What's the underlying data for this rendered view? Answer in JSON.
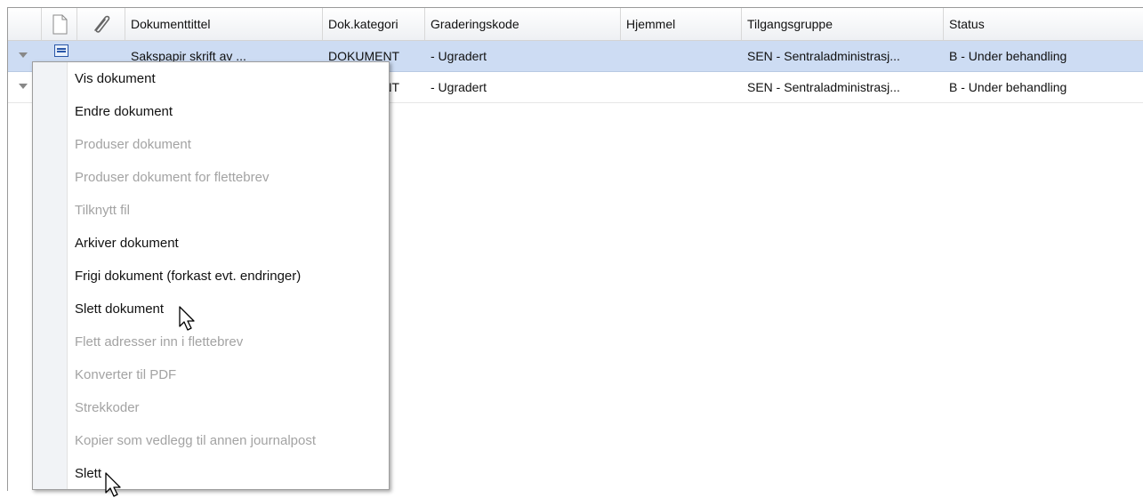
{
  "header": {
    "columns": {
      "doc_title": "Dokumenttittel",
      "doc_category": "Dok.kategori",
      "grading_code": "Graderingskode",
      "authority": "Hjemmel",
      "access_group": "Tilgangsgruppe",
      "status": "Status"
    }
  },
  "rows": [
    {
      "title": "Sakspapir skrift av ...",
      "category": "DOKUMENT",
      "grading": "- Ugradert",
      "authority": "",
      "access_group": "SEN - Sentraladministrasj...",
      "status": "B - Under behandling"
    },
    {
      "title": "",
      "category": "DOKUMENT",
      "grading": "- Ugradert",
      "authority": "",
      "access_group": "SEN - Sentraladministrasj...",
      "status": "B - Under behandling"
    }
  ],
  "context_menu": {
    "items": [
      {
        "label": "Vis dokument",
        "enabled": true
      },
      {
        "label": "Endre dokument",
        "enabled": true
      },
      {
        "label": "Produser dokument",
        "enabled": false
      },
      {
        "label": "Produser dokument for flettebrev",
        "enabled": false
      },
      {
        "label": "Tilknytt fil",
        "enabled": false
      },
      {
        "label": "Arkiver dokument",
        "enabled": true
      },
      {
        "label": "Frigi dokument (forkast evt. endringer)",
        "enabled": true
      },
      {
        "label": "Slett dokument",
        "enabled": true
      },
      {
        "label": "Flett adresser inn i flettebrev",
        "enabled": false
      },
      {
        "label": "Konverter til PDF",
        "enabled": false
      },
      {
        "label": "Strekkoder",
        "enabled": false
      },
      {
        "label": "Kopier som vedlegg til annen journalpost",
        "enabled": false
      },
      {
        "label": "Slett",
        "enabled": true
      }
    ]
  },
  "colors": {
    "selected_row": "#cddcf3",
    "disabled_text": "#a3a3a3",
    "header_bg": "#eef0f3"
  },
  "icons": {
    "document_column": "document-icon",
    "attachment_column": "paperclip-icon",
    "row_expander": "triangle-down-icon",
    "row_doc_type": "document-type-icon"
  }
}
